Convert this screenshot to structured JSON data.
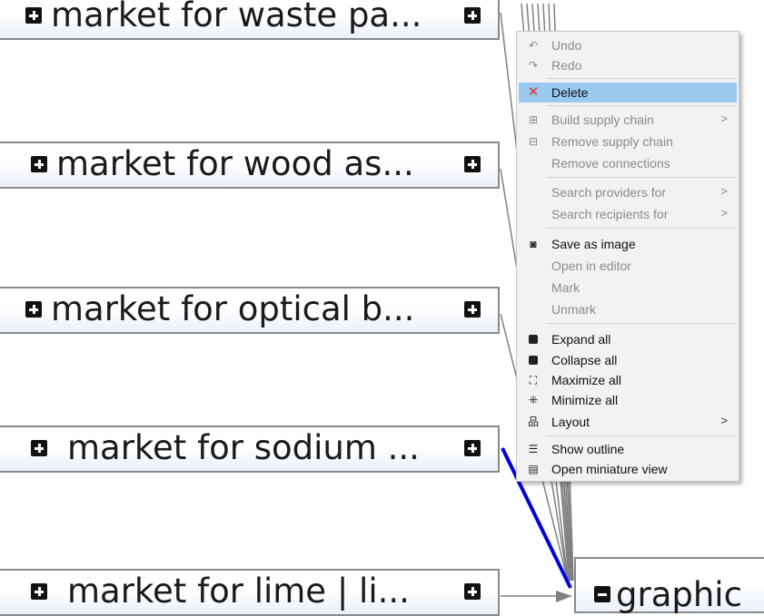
{
  "nodes": [
    {
      "label": "market for waste pa..."
    },
    {
      "label": "market for wood as..."
    },
    {
      "label": "market for optical b..."
    },
    {
      "label": "market for sodium ..."
    },
    {
      "label": "market for lime | li..."
    }
  ],
  "target": {
    "label": "graphic"
  },
  "context_menu": {
    "undo": "Undo",
    "redo": "Redo",
    "delete": "Delete",
    "build_supply_chain": "Build supply chain",
    "remove_supply_chain": "Remove supply chain",
    "remove_connections": "Remove connections",
    "search_providers": "Search providers for",
    "search_recipients": "Search recipients for",
    "save_as_image": "Save as image",
    "open_in_editor": "Open in editor",
    "mark": "Mark",
    "unmark": "Unmark",
    "expand_all": "Expand all",
    "collapse_all": "Collapse all",
    "maximize_all": "Maximize all",
    "minimize_all": "Minimize all",
    "layout": "Layout",
    "show_outline": "Show outline",
    "open_miniature_view": "Open miniature view",
    "submenu_arrow": ">"
  },
  "colors": {
    "highlight": "#99c9ef",
    "selected_link": "#0000e6",
    "link": "#808080",
    "delete_icon": "#e0302f"
  },
  "icons": {
    "undo": "undo-icon",
    "redo": "redo-icon",
    "delete": "close-x-icon",
    "build": "build-supply-chain-icon",
    "remove": "remove-supply-chain-icon",
    "save": "camera-icon",
    "expand": "plus-square-icon",
    "collapse": "minus-square-icon",
    "maximize": "maximize-icon",
    "minimize": "minimize-icon",
    "layout": "layout-tree-icon",
    "outline": "outline-icon",
    "miniature": "miniature-view-icon"
  }
}
